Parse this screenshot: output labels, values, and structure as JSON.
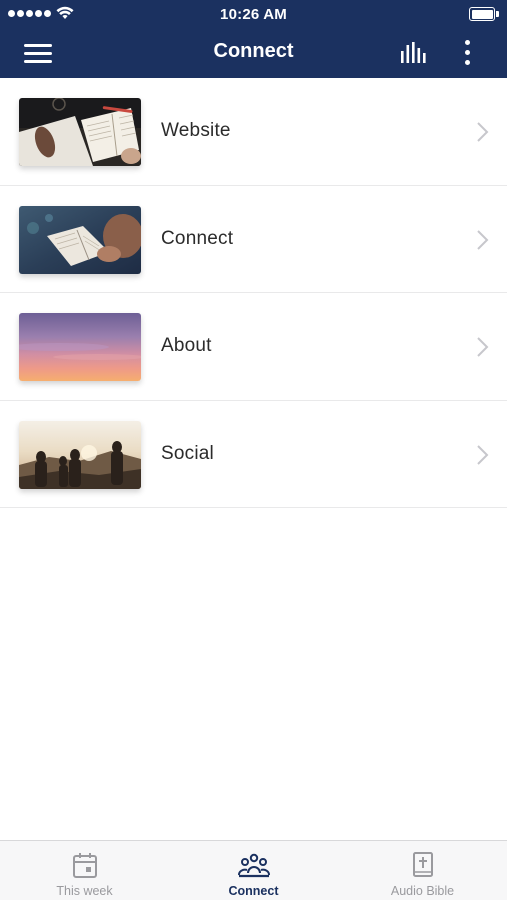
{
  "status_bar": {
    "time": "10:26 AM"
  },
  "header": {
    "title": "Connect"
  },
  "items": [
    {
      "label": "Website",
      "image": "open-bible-with-pen-photo"
    },
    {
      "label": "Connect",
      "image": "hands-holding-bible-photo"
    },
    {
      "label": "About",
      "image": "purple-sunset-sky-photo"
    },
    {
      "label": "Social",
      "image": "friends-on-hill-at-sunset-photo"
    }
  ],
  "tabs": [
    {
      "label": "This week",
      "icon": "calendar-icon",
      "active": false
    },
    {
      "label": "Connect",
      "icon": "people-group-icon",
      "active": true
    },
    {
      "label": "Audio Bible",
      "icon": "bible-book-icon",
      "active": false
    }
  ],
  "colors": {
    "brand": "#1b3160",
    "inactive": "#9a9a9e",
    "text": "#2b2b2b"
  }
}
